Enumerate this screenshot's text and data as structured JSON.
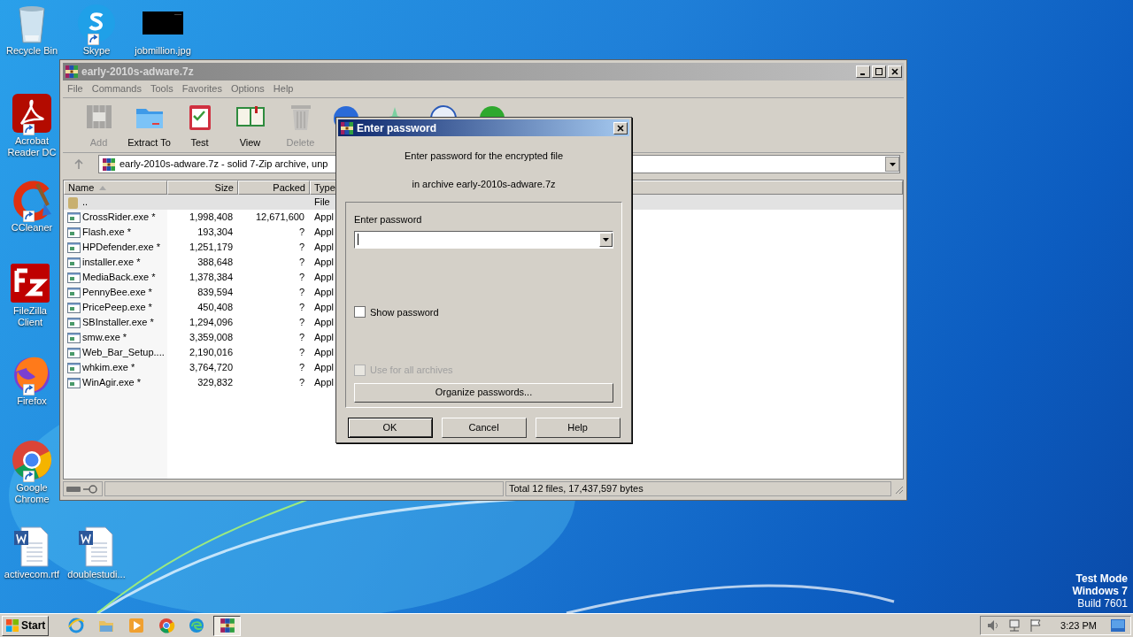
{
  "desktop_icons": [
    {
      "label": "Recycle Bin",
      "kind": "recycle",
      "shortcut": false
    },
    {
      "label": "Skype",
      "kind": "skype",
      "shortcut": true
    },
    {
      "label": "jobmillion.jpg",
      "kind": "image",
      "shortcut": false
    },
    {
      "label": "Acrobat Reader DC",
      "kind": "acrobat",
      "shortcut": true
    },
    {
      "label": "CCleaner",
      "kind": "ccleaner",
      "shortcut": true
    },
    {
      "label": "FileZilla Client",
      "kind": "filezilla",
      "shortcut": false
    },
    {
      "label": "Firefox",
      "kind": "firefox",
      "shortcut": true
    },
    {
      "label": "Google Chrome",
      "kind": "chrome",
      "shortcut": true
    },
    {
      "label": "activecom.rtf",
      "kind": "word",
      "shortcut": false
    },
    {
      "label": "doublestudi...",
      "kind": "word",
      "shortcut": false
    }
  ],
  "archive_window": {
    "title": "early-2010s-adware.7z",
    "menu": [
      "File",
      "Commands",
      "Tools",
      "Favorites",
      "Options",
      "Help"
    ],
    "toolbar": [
      {
        "label": "Add",
        "kind": "add",
        "disabled": true
      },
      {
        "label": "Extract To",
        "kind": "extract",
        "disabled": false
      },
      {
        "label": "Test",
        "kind": "test",
        "disabled": false
      },
      {
        "label": "View",
        "kind": "view",
        "disabled": false
      },
      {
        "label": "Delete",
        "kind": "delete",
        "disabled": true
      }
    ],
    "address": "early-2010s-adware.7z - solid 7-Zip archive, unp",
    "columns": [
      "Name",
      "Size",
      "Packed",
      "Type"
    ],
    "rows": [
      {
        "name": "..",
        "type": "File",
        "kind": "folder"
      },
      {
        "name": "CrossRider.exe *",
        "size": "1,998,408",
        "packed": "12,671,600",
        "type": "Appl",
        "kind": "exe"
      },
      {
        "name": "Flash.exe *",
        "size": "193,304",
        "packed": "?",
        "type": "Appl",
        "kind": "exe"
      },
      {
        "name": "HPDefender.exe *",
        "size": "1,251,179",
        "packed": "?",
        "type": "Appl",
        "kind": "exe"
      },
      {
        "name": "installer.exe *",
        "size": "388,648",
        "packed": "?",
        "type": "Appl",
        "kind": "exe"
      },
      {
        "name": "MediaBack.exe *",
        "size": "1,378,384",
        "packed": "?",
        "type": "Appl",
        "kind": "exe"
      },
      {
        "name": "PennyBee.exe *",
        "size": "839,594",
        "packed": "?",
        "type": "Appl",
        "kind": "exe"
      },
      {
        "name": "PricePeep.exe *",
        "size": "450,408",
        "packed": "?",
        "type": "Appl",
        "kind": "exe"
      },
      {
        "name": "SBInstaller.exe *",
        "size": "1,294,096",
        "packed": "?",
        "type": "Appl",
        "kind": "exe"
      },
      {
        "name": "smw.exe *",
        "size": "3,359,008",
        "packed": "?",
        "type": "Appl",
        "kind": "exe"
      },
      {
        "name": "Web_Bar_Setup....",
        "size": "2,190,016",
        "packed": "?",
        "type": "Appl",
        "kind": "exe"
      },
      {
        "name": "whkim.exe *",
        "size": "3,764,720",
        "packed": "?",
        "type": "Appl",
        "kind": "exe"
      },
      {
        "name": "WinAgir.exe *",
        "size": "329,832",
        "packed": "?",
        "type": "Appl",
        "kind": "exe"
      }
    ],
    "status": "Total 12 files, 17,437,597 bytes"
  },
  "dialog": {
    "title": "Enter password",
    "message": "Enter password for the encrypted file",
    "archive_line": "in archive early-2010s-adware.7z",
    "field_label": "Enter password",
    "checkboxes": [
      {
        "label": "Show password",
        "checked": false,
        "disabled": false
      },
      {
        "label": "Use for all archives",
        "checked": false,
        "disabled": true
      }
    ],
    "organize_button": "Organize passwords...",
    "buttons": [
      {
        "label": "OK",
        "selected": true
      },
      {
        "label": "Cancel",
        "selected": false
      },
      {
        "label": "Help",
        "selected": false
      }
    ]
  },
  "taskbar": {
    "start": "Start",
    "apps": [
      {
        "kind": "ie",
        "selected": false
      },
      {
        "kind": "explorer",
        "selected": false
      },
      {
        "kind": "media",
        "selected": false
      },
      {
        "kind": "chrome",
        "selected": false
      },
      {
        "kind": "edge",
        "selected": false
      },
      {
        "kind": "winrar",
        "selected": true
      }
    ],
    "clock": "3:23 PM"
  },
  "os_notice": [
    "Test Mode",
    "Windows 7",
    "Build 7601"
  ]
}
